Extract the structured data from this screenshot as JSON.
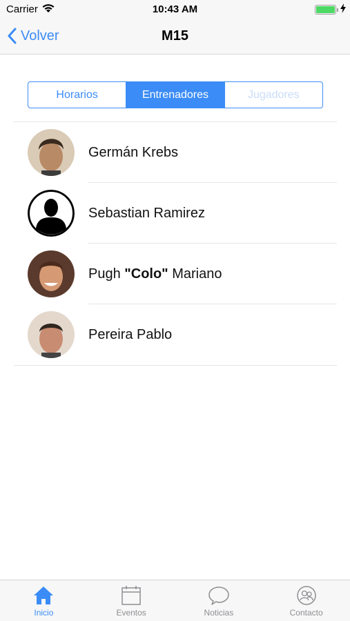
{
  "status_bar": {
    "carrier": "Carrier",
    "time": "10:43 AM",
    "battery_level": 1.0
  },
  "nav": {
    "back_label": "Volver",
    "title": "M15"
  },
  "segments": [
    {
      "label": "Horarios",
      "state": "normal"
    },
    {
      "label": "Entrenadores",
      "state": "selected"
    },
    {
      "label": "Jugadores",
      "state": "disabled"
    }
  ],
  "coaches": [
    {
      "name": "Germán Krebs",
      "avatar": "photo"
    },
    {
      "name": "Sebastian Ramirez",
      "avatar": "placeholder-silhouette"
    },
    {
      "name_prefix": "Pugh ",
      "nickname": "\"Colo\"",
      "name_suffix": " Mariano",
      "avatar": "photo"
    },
    {
      "name": "Pereira Pablo",
      "avatar": "photo"
    }
  ],
  "tabs": [
    {
      "label": "Inicio",
      "icon": "home-icon",
      "active": true
    },
    {
      "label": "Eventos",
      "icon": "calendar-icon",
      "active": false
    },
    {
      "label": "Noticias",
      "icon": "chat-bubble-icon",
      "active": false
    },
    {
      "label": "Contacto",
      "icon": "contact-icon",
      "active": false
    }
  ],
  "colors": {
    "accent": "#3b8cf6",
    "inactive_tab": "#8e8e93",
    "battery": "#4cd964"
  }
}
